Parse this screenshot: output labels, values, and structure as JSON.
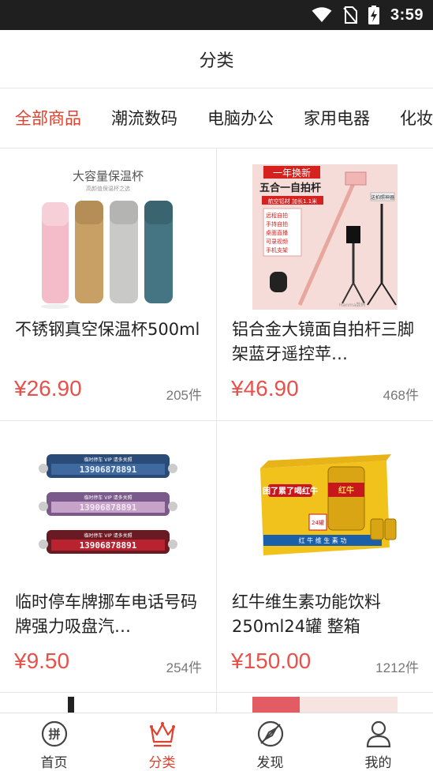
{
  "status_bar": {
    "time": "3:59",
    "icons": [
      "wifi-icon",
      "no-sim-icon",
      "battery-charging-icon"
    ]
  },
  "header": {
    "title": "分类"
  },
  "tabs": [
    {
      "label": "全部商品",
      "active": true
    },
    {
      "label": "潮流数码",
      "active": false
    },
    {
      "label": "电脑办公",
      "active": false
    },
    {
      "label": "家用电器",
      "active": false
    },
    {
      "label": "化妆",
      "active": false
    }
  ],
  "products": [
    {
      "name": "不锈钢真空保温杯500ml",
      "price": "¥26.90",
      "sold": "205件",
      "image_text": "大容量保温杯",
      "image_subtext": "高颜值保温杯之选"
    },
    {
      "name": "铝合金大镜面自拍杆三脚架蓝牙遥控苹…",
      "price": "¥46.90",
      "sold": "468件",
      "image_text": "一年换新",
      "image_subtext": "五合一自拍杆",
      "image_tag": "航空铝材 加长1.1米",
      "image_features": [
        "远程自拍",
        "手持自拍",
        "桌面直播",
        "可录视频",
        "手机支架"
      ],
      "image_brand": "Hanma数码",
      "image_side_label": "送拍照神器"
    },
    {
      "name": "临时停车牌挪车电话号码牌强力吸盘汽…",
      "price": "¥9.50",
      "sold": "254件",
      "image_header": "临时停车 VIP 请多关照",
      "image_number": "13906878891"
    },
    {
      "name": "红牛维生素功能饮料250ml24罐 整箱",
      "price": "¥150.00",
      "sold": "1212件",
      "image_slogan": "困了累了喝红牛",
      "image_brand": "红牛",
      "image_bottom": "红 牛 维 生 素 功",
      "image_pack": "24罐"
    }
  ],
  "bottom_nav": [
    {
      "label": "首页",
      "icon": "pin-coin-icon",
      "active": false
    },
    {
      "label": "分类",
      "icon": "crown-icon",
      "active": true
    },
    {
      "label": "发现",
      "icon": "compass-icon",
      "active": false
    },
    {
      "label": "我的",
      "icon": "user-icon",
      "active": false
    }
  ],
  "colors": {
    "accent": "#e0412d",
    "price": "#e8504a",
    "status_bar": "#1f1f1f"
  }
}
